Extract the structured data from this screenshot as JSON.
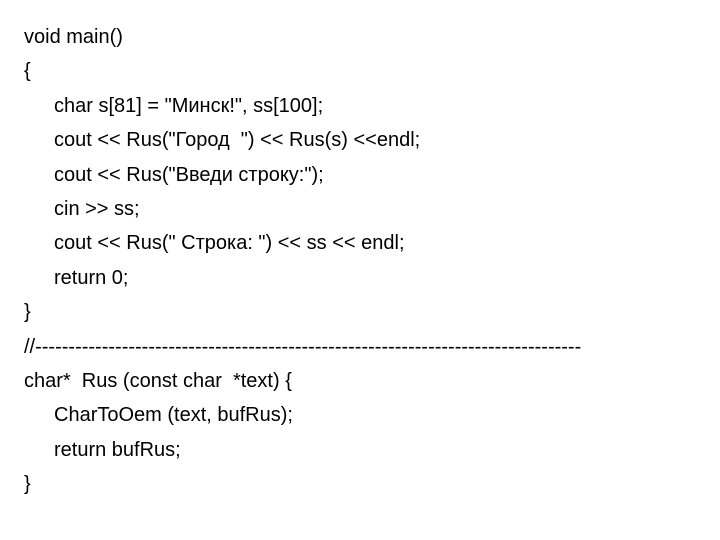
{
  "code": {
    "l1": "void main()",
    "l2": "{",
    "l3": "char s[81] = \"Минск!\", ss[100];",
    "l4": "cout << Rus(\"Город  \") << Rus(s) <<endl;",
    "l5": "cout << Rus(\"Введи строку:\");",
    "l6": "cin >> ss;",
    "l7": "cout << Rus(\" Строка: \") << ss << endl;",
    "l8": "return 0;",
    "l9": "}",
    "l10": "//----------------------------------------------------------------------------------",
    "l11": "char*  Rus (const char  *text) {",
    "l12": "CharToOem (text, bufRus);",
    "l13": "return bufRus;",
    "l14": "}"
  }
}
